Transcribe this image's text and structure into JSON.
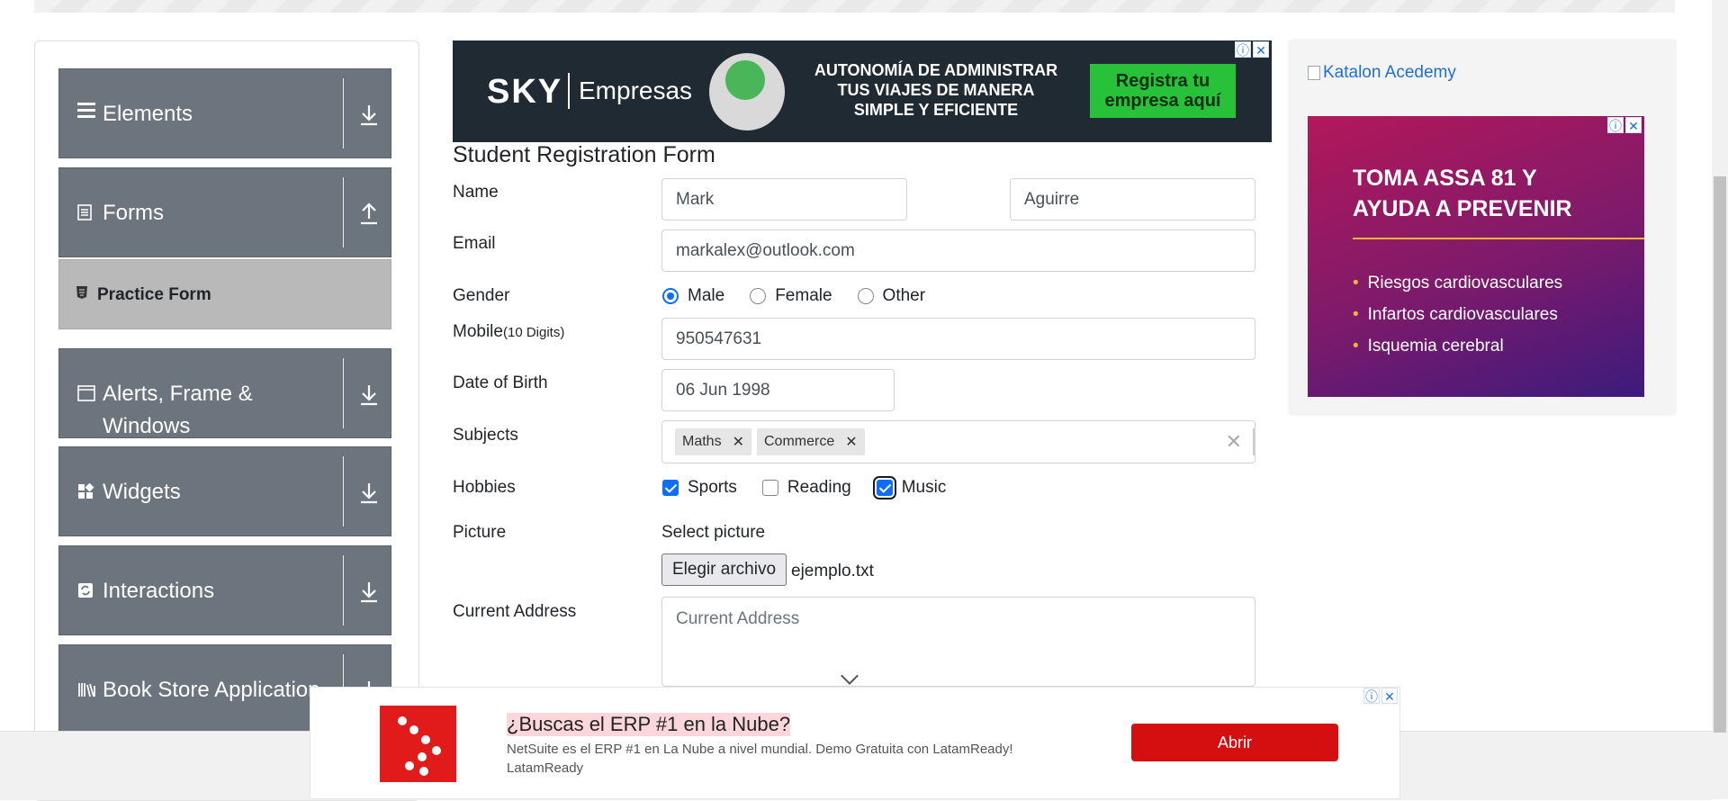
{
  "sidebar": {
    "groups": [
      {
        "label": "Elements",
        "icon": "hamburger-icon",
        "arrow": "download-icon"
      },
      {
        "label": "Forms",
        "icon": "document-icon",
        "arrow": "upload-icon"
      },
      {
        "label": "Alerts, Frame & Windows",
        "icon": "window-icon",
        "arrow": "download-icon"
      },
      {
        "label": "Widgets",
        "icon": "widgets-icon",
        "arrow": "download-icon"
      },
      {
        "label": "Interactions",
        "icon": "refresh-icon",
        "arrow": "download-icon"
      },
      {
        "label": "Book Store Application",
        "icon": "books-icon",
        "arrow": "download-icon"
      }
    ],
    "active_item": {
      "label": "Practice Form",
      "icon": "html5-icon"
    }
  },
  "ads": {
    "top": {
      "brand": "SKY",
      "brand2": "Empresas",
      "tagline": "AUTONOMÍA DE ADMINISTRAR TUS VIAJES DE MANERA SIMPLE Y EFICIENTE",
      "cta": "Registra tu empresa aquí"
    },
    "right_link": "Katalon Acedemy",
    "right": {
      "headline": "TOMA ASSA 81 Y AYUDA A PREVENIR",
      "bullets": [
        "Riesgos cardiovasculares",
        "Infartos cardiovasculares",
        "Isquemia cerebral"
      ]
    },
    "bottom": {
      "title": "¿Buscas el ERP #1 en la Nube?",
      "description": "NetSuite es el ERP #1 en La Nube a nivel mundial. Demo Gratuita con LatamReady! LatamReady",
      "button": "Abrir"
    }
  },
  "form": {
    "title": "Student Registration Form",
    "name_label": "Name",
    "first_name": "Mark",
    "last_name": "Aguirre",
    "email_label": "Email",
    "email": "markalex@outlook.com",
    "gender_label": "Gender",
    "gender_options": [
      "Male",
      "Female",
      "Other"
    ],
    "gender_selected": "Male",
    "mobile_label": "Mobile",
    "mobile_hint": "(10 Digits)",
    "mobile": "950547631",
    "dob_label": "Date of Birth",
    "dob": "06 Jun 1998",
    "subjects_label": "Subjects",
    "subjects": [
      "Maths",
      "Commerce"
    ],
    "hobbies_label": "Hobbies",
    "hobbies": [
      {
        "label": "Sports",
        "checked": true
      },
      {
        "label": "Reading",
        "checked": false
      },
      {
        "label": "Music",
        "checked": true
      }
    ],
    "picture_label": "Picture",
    "select_picture": "Select picture",
    "file_button": "Elegir archivo",
    "file_name": "ejemplo.txt",
    "address_label": "Current Address",
    "address_placeholder": "Current Address"
  },
  "colors": {
    "sidebar_bg": "#6c757d",
    "active_item_bg": "#b9b9b9",
    "accent": "#0d6efd",
    "bottom_ad_button": "#d50f0f"
  }
}
